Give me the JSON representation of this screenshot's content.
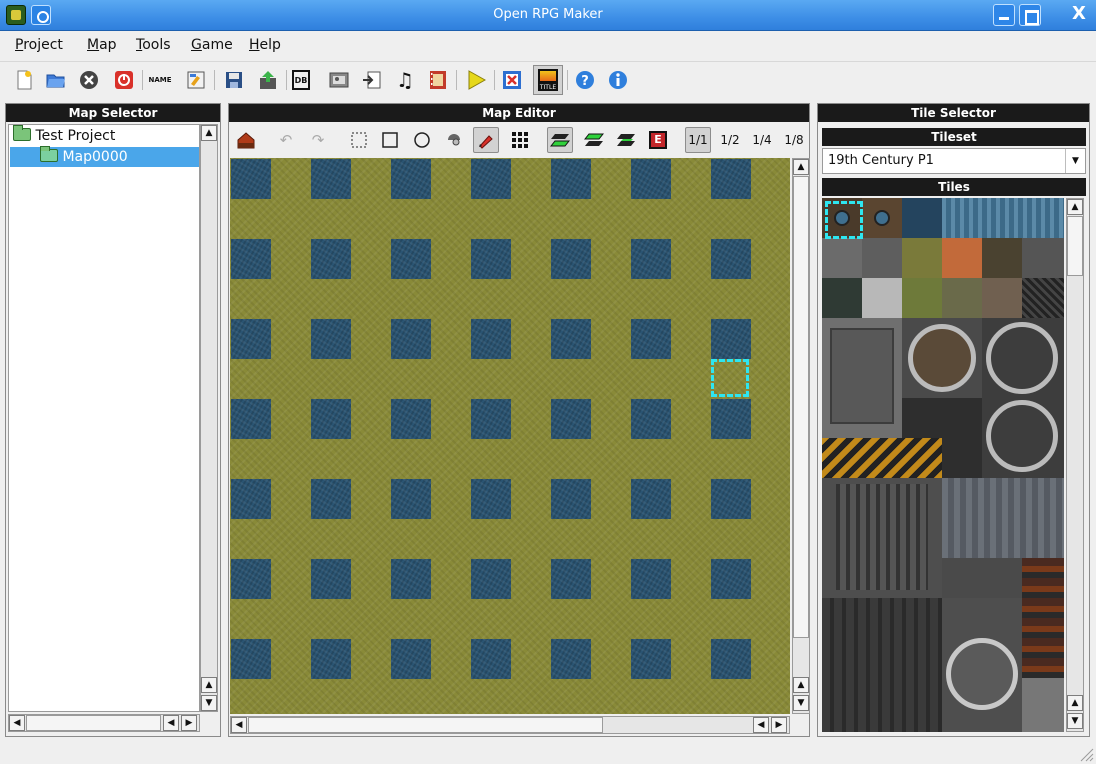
{
  "window": {
    "title": "Open RPG Maker",
    "close_glyph": "X"
  },
  "menu": [
    "Project",
    "Map",
    "Tools",
    "Game",
    "Help"
  ],
  "toolbar": {
    "icons": [
      "new-project-icon",
      "open-project-icon",
      "close-project-icon",
      "quit-icon",
      "name-icon",
      "properties-icon",
      "save-icon",
      "export-icon",
      "database-icon",
      "images-icon",
      "import-icon",
      "music-icon",
      "film-icon",
      "play-game-icon",
      "fullscreen-icon",
      "title-screen-icon",
      "help-icon",
      "about-icon"
    ],
    "name_label": "NAME",
    "title_label": "TITLE",
    "database_label": "DB"
  },
  "map_selector": {
    "header": "Map Selector",
    "project": "Test Project",
    "map": "Map0000"
  },
  "map_editor": {
    "header": "Map Editor",
    "tools": [
      "house-icon",
      "undo-icon",
      "redo-icon",
      "select-icon",
      "rectangle-icon",
      "circle-icon",
      "fill-icon",
      "pencil-icon",
      "grid-icon",
      "layer-lower-icon",
      "layer-upper-icon",
      "layer-events-icon",
      "event-icon"
    ],
    "event_label": "E",
    "zoom": [
      "1/1",
      "1/2",
      "1/4",
      "1/8"
    ]
  },
  "tile_selector": {
    "header": "Tile Selector",
    "tileset_header": "Tileset",
    "tileset": "19th Century P1",
    "tiles_header": "Tiles"
  },
  "colors": {
    "selection": "#4aa6ea",
    "grass": "#898a38",
    "water": "#2a5472",
    "cursor": "#2ee6f0"
  }
}
